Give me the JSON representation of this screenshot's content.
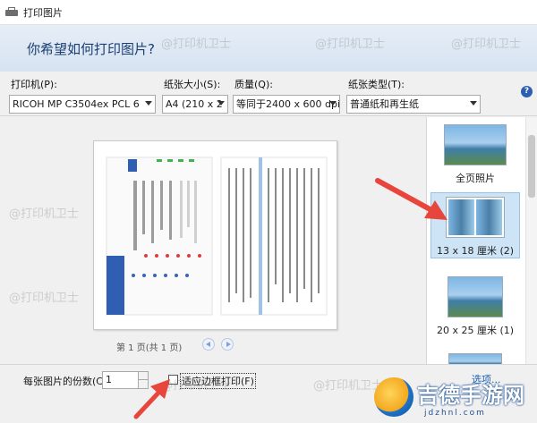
{
  "window": {
    "title": "打印图片"
  },
  "header": {
    "heading": "你希望如何打印图片?"
  },
  "controls": {
    "printer": {
      "label": "打印机(P):",
      "value": "RICOH MP C3504ex PCL 6"
    },
    "paper_size": {
      "label": "纸张大小(S):",
      "value": "A4 (210 x 2"
    },
    "quality": {
      "label": "质量(Q):",
      "value": "等同于2400 x 600 dpi"
    },
    "paper_type": {
      "label": "纸张类型(T):",
      "value": "普通纸和再生纸"
    }
  },
  "preview": {
    "page_indicator": "第 1 页(共 1 页)"
  },
  "layouts": [
    {
      "label": "全页照片",
      "selected": false
    },
    {
      "label": "13 x 18 厘米 (2)",
      "selected": true
    },
    {
      "label": "20 x 25 厘米 (1)",
      "selected": false
    }
  ],
  "footer": {
    "copies_label": "每张图片的份数(C):",
    "copies_value": "1",
    "fit_label": "适应边框打印(F)",
    "fit_checked": false,
    "options_label": "选项..."
  },
  "watermark_text": "@打印机卫士",
  "logo": {
    "title": "吉德手游网",
    "domain": "jdzhnl.com"
  },
  "colors": {
    "header_bg": "#dde8f4",
    "heading": "#1c3f72",
    "selection": "#cde4f7",
    "annotation_arrow": "#e8453c"
  }
}
